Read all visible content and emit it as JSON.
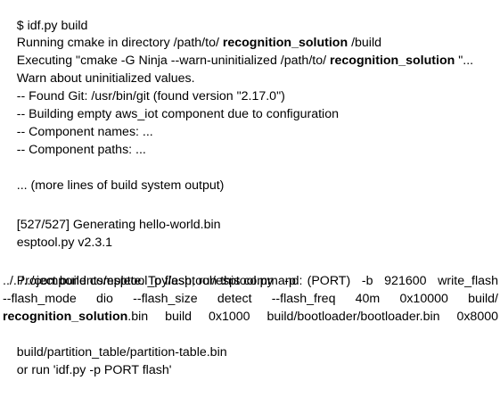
{
  "terminal": {
    "lines": {
      "cmd": "$ idf.py build",
      "run_a": "Running cmake in directory /path/to/ ",
      "run_b": "recognition_solution",
      "run_c": " /build",
      "exec_a": "Executing \"cmake -G Ninja --warn-uninitialized /path/to/ ",
      "exec_b": "recognition_solution",
      "exec_c": " \"...",
      "warn": "Warn about uninitialized values.",
      "git": "-- Found Git: /usr/bin/git (found version \"2.17.0\")",
      "aws": "-- Building empty aws_iot component due to configuration",
      "comp_names": "-- Component names: ...",
      "comp_paths": "-- Component paths: ...",
      "more": "... (more lines of build system output)",
      "gen": "[527/527] Generating hello-world.bin",
      "esptool": "esptool.py v2.3.1",
      "complete": "Project build complete. To flash, run this command:",
      "flash1": "../../../components/esptool_py/esptool/esptool.py -p (PORT) -b 921600 write_flash",
      "flash2": "--flash_mode dio --flash_size detect --flash_freq 40m 0x10000 build/",
      "flash3_b": "recognition_solution",
      "flash3_a": ".bin build 0x1000 build/bootloader/bootloader.bin 0x8000",
      "flash4": "build/partition_table/partition-table.bin",
      "or_run": "or run 'idf.py -p PORT flash'"
    }
  }
}
